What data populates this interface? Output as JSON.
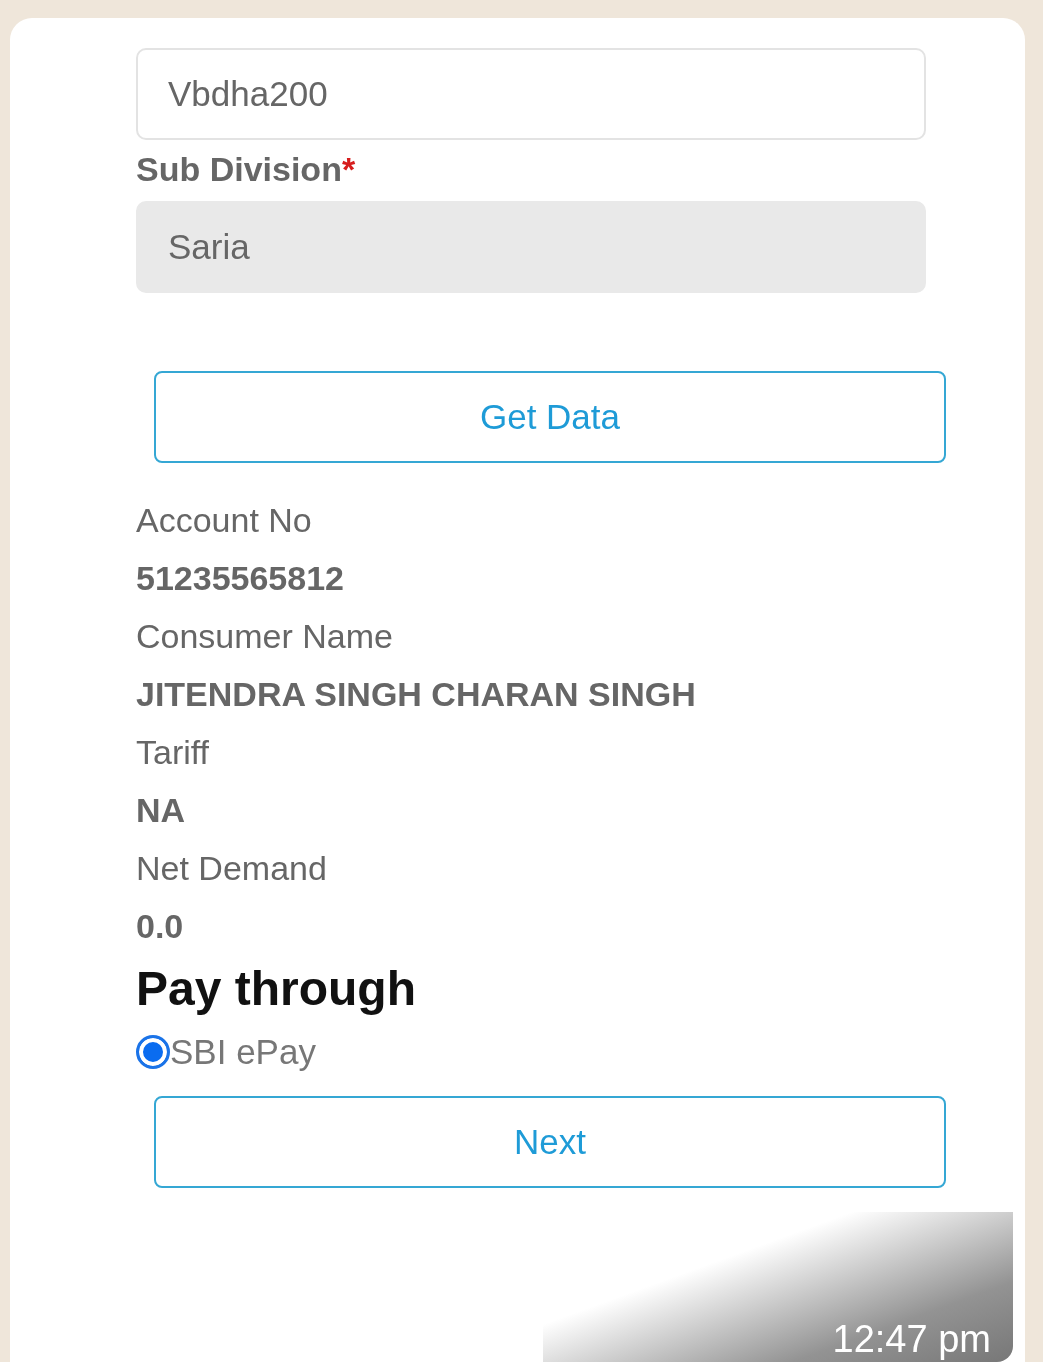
{
  "login_field": {
    "value": "Vbdha200"
  },
  "sub_division": {
    "label": "Sub Division",
    "required_mark": "*",
    "value": "Saria",
    "disabled": true
  },
  "get_data_button": {
    "label": "Get Data"
  },
  "details": [
    {
      "label": "Account No",
      "value": "51235565812"
    },
    {
      "label": "Consumer Name",
      "value": "JITENDRA SINGH CHARAN SINGH"
    },
    {
      "label": "Tariff",
      "value": "NA"
    },
    {
      "label": "Net Demand",
      "value": "0.0"
    }
  ],
  "pay_through": {
    "heading": "Pay through",
    "options": [
      {
        "label": "SBI ePay",
        "selected": true
      }
    ]
  },
  "next_button": {
    "label": "Next"
  },
  "timestamp": "12:47 pm"
}
